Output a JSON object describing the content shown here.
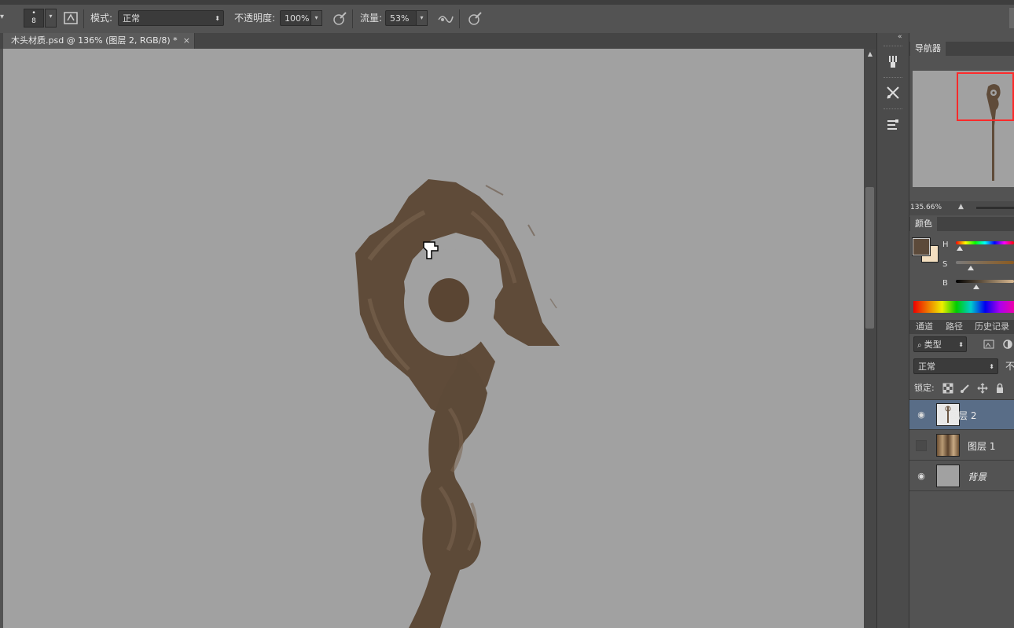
{
  "options_bar": {
    "brush_size": "8",
    "mode_label": "模式:",
    "mode_value": "正常",
    "opacity_label": "不透明度:",
    "opacity_value": "100%",
    "flow_label": "流量:",
    "flow_value": "53%"
  },
  "document_tab": {
    "title": "木头材质.psd @ 136% (图层 2, RGB/8) *",
    "close": "×"
  },
  "navigator": {
    "tab_label": "导航器",
    "zoom": "135.66%"
  },
  "color_panel": {
    "tab_label": "颜色",
    "h_label": "H",
    "s_label": "S",
    "b_label": "B",
    "foreground": "#5c4a3a",
    "background": "#f4dfc0",
    "h_fraction": 0.07,
    "s_fraction": 0.25,
    "b_fraction": 0.35
  },
  "layers_panel": {
    "tabs": [
      "通道",
      "路径",
      "历史记录"
    ],
    "filter_label": "类型",
    "blend_mode": "正常",
    "opacity_label_partial": "不",
    "lock_label": "锁定:",
    "layers": [
      {
        "name": "图层 2",
        "visible": true,
        "selected": true
      },
      {
        "name": "图层 1",
        "visible": false,
        "selected": false
      },
      {
        "name": "背景",
        "visible": true,
        "selected": false
      }
    ]
  },
  "colors": {
    "canvas": "#a1a1a1",
    "paint": "#5e4a38",
    "selected_layer": "#596d87",
    "nav_frame": "#ff2a2a"
  }
}
